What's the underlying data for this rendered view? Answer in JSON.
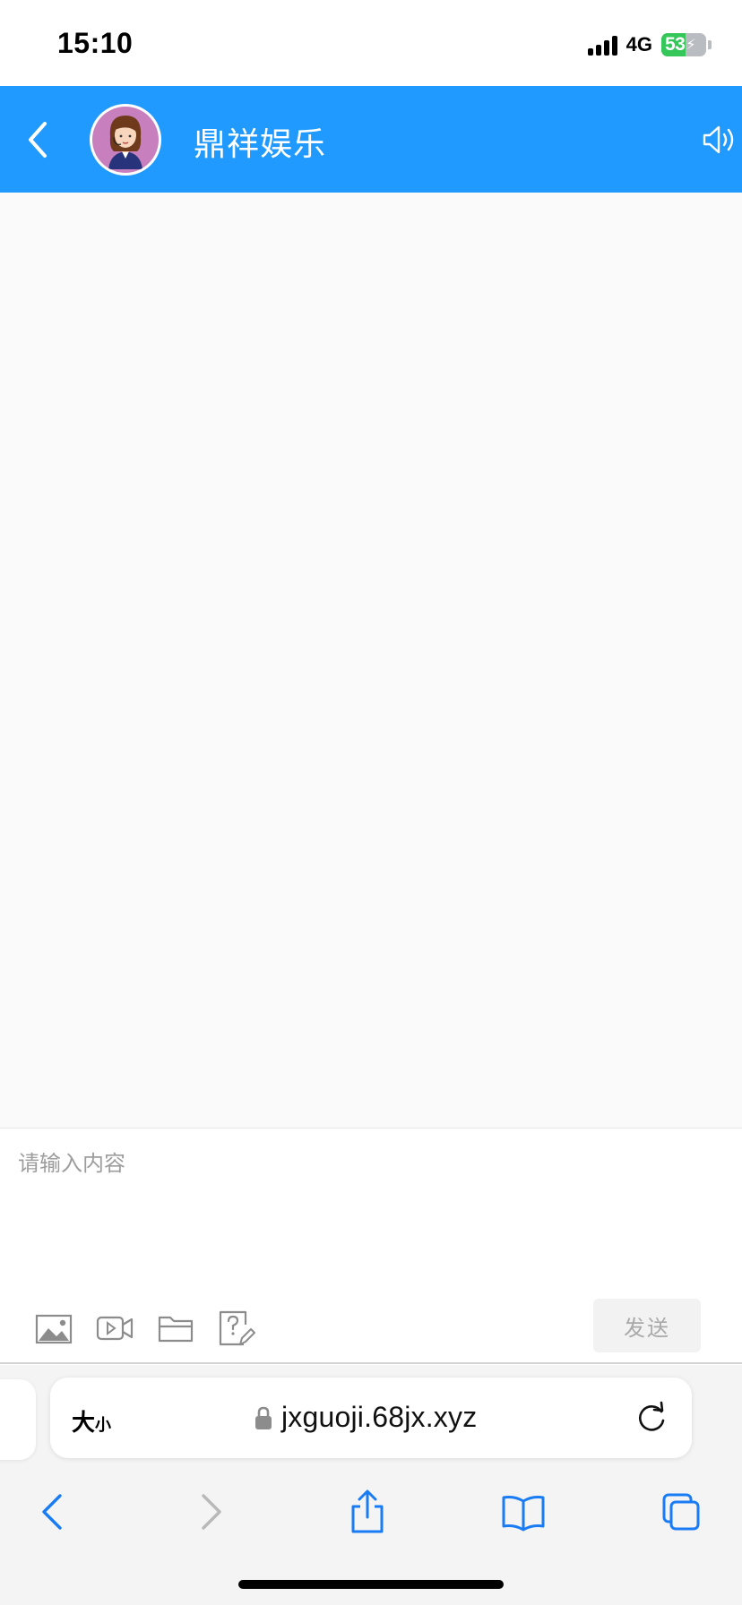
{
  "status_bar": {
    "time": "15:10",
    "network": "4G",
    "battery": "53",
    "battery_level": 0.53,
    "icons": [
      "signal-icon",
      "battery-icon",
      "charging-bolt-icon"
    ]
  },
  "header": {
    "title": "鼎祥娱乐",
    "background": "#209afe",
    "icons": [
      "back-chevron-icon",
      "agent-avatar",
      "speaker-icon"
    ]
  },
  "composer": {
    "placeholder": "请输入内容",
    "send_label": "发送",
    "tools": [
      "image-icon",
      "video-icon",
      "folder-icon",
      "question-edit-icon"
    ]
  },
  "browser": {
    "text_size_large": "大",
    "text_size_small": "小",
    "url": "jxguoji.68jx.xyz",
    "accent": "#1a7cf5",
    "icons": [
      "lock-icon",
      "reload-icon",
      "nav-back-icon",
      "nav-forward-icon",
      "share-icon",
      "bookmarks-icon",
      "tabs-icon"
    ]
  }
}
